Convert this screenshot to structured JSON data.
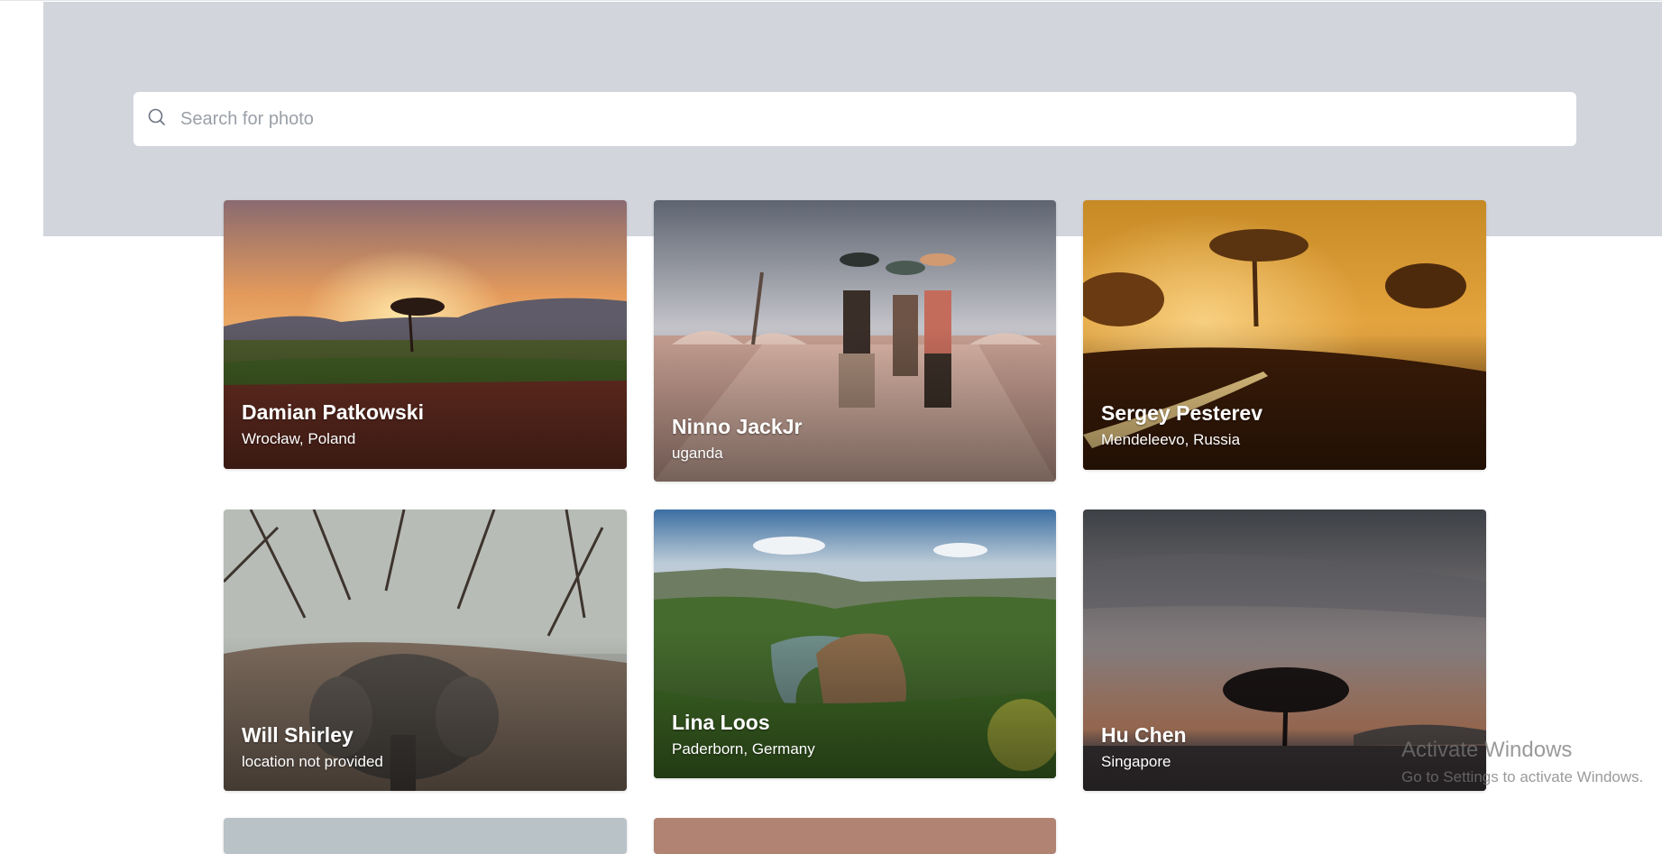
{
  "search": {
    "placeholder": "Search for photo"
  },
  "cards": [
    {
      "name": "Damian Patkowski",
      "location": "Wrocław, Poland"
    },
    {
      "name": "Ninno JackJr",
      "location": "uganda"
    },
    {
      "name": "Sergey Pesterev",
      "location": "Mendeleevo, Russia"
    },
    {
      "name": "Will Shirley",
      "location": "location not provided"
    },
    {
      "name": "Lina Loos",
      "location": "Paderborn, Germany"
    },
    {
      "name": "Hu Chen",
      "location": "Singapore"
    }
  ],
  "watermark": {
    "title": "Activate Windows",
    "subtitle": "Go to Settings to activate Windows."
  }
}
